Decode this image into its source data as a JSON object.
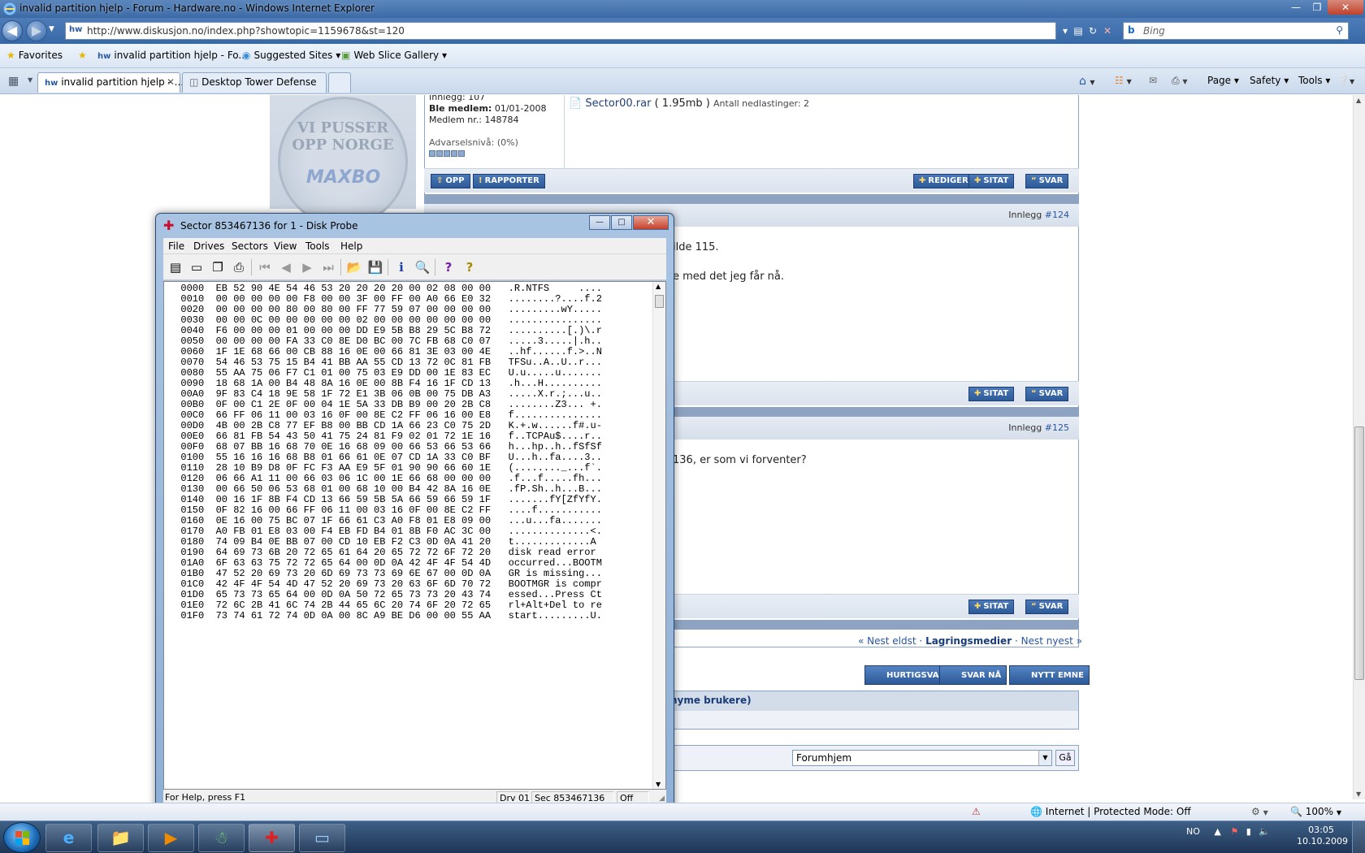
{
  "ie": {
    "title": "invalid partition hjelp - Forum - Hardware.no - Windows Internet Explorer",
    "url": "http://www.diskusjon.no/index.php?showtopic=1159678&st=120",
    "search_placeholder": "Bing",
    "favorites": {
      "favorites_label": "Favorites",
      "items": [
        "invalid partition hjelp - Fo...",
        "Suggested Sites ▾",
        "Web Slice Gallery ▾"
      ]
    },
    "tabs": [
      "invalid partition hjelp - ...",
      "Desktop Tower Defense"
    ],
    "commands": [
      "Page ▾",
      "Safety ▾",
      "Tools ▾"
    ],
    "status": {
      "zone": "Internet | Protected Mode: Off",
      "zoom": "100%"
    }
  },
  "forum": {
    "user": {
      "innlegg": "Innlegg: 107",
      "ble_medlem_label": "Ble medlem:",
      "ble_medlem": "01/01-2008",
      "medlem_nr": "Medlem nr.: 148784",
      "advarsel": "Advarselsnivå: (0%)"
    },
    "attachment": {
      "name": "Sector00.rar",
      "size": "( 1.95mb )",
      "downloads": "Antall nedlastinger: 2"
    },
    "buttons": {
      "opp": "OPP",
      "rapporter": "RAPPORTER",
      "rediger": "REDIGER",
      "sitat": "SITAT",
      "svar": "SVAR"
    },
    "posts": [
      {
        "innlegg_label": "Innlegg",
        "num": "#124",
        "line1": "ilde 115.",
        "line2": "e med det jeg får nå."
      },
      {
        "innlegg_label": "Innlegg",
        "num": "#125",
        "line1": "136, er som vi forventer?"
      }
    ],
    "pager": {
      "prev": "« Nest eldst",
      "sep": "·",
      "cat": "Lagringsmedier",
      "next": "Nest nyest »"
    },
    "big_buttons": [
      "HURTIGSVAR",
      "SVAR NÅ",
      "NYTT EMNE"
    ],
    "online_header": "nyme brukere)",
    "jump": {
      "selected": "Forumhjem",
      "go": "Gå"
    },
    "seal_top": "VI PUSSER OPP NORGE",
    "seal_logo": "MAXBO"
  },
  "diskprobe": {
    "title": "Sector 853467136 for 1 - Disk Probe",
    "menu": [
      "File",
      "Drives",
      "Sectors",
      "View",
      "Tools",
      "Help"
    ],
    "rows": [
      [
        "0000",
        "EB 52 90 4E 54 46 53 20 20 20 20 00 02 08 00 00",
        ".R.NTFS     ...."
      ],
      [
        "0010",
        "00 00 00 00 00 F8 00 00 3F 00 FF 00 A0 66 E0 32",
        "........?....f.2"
      ],
      [
        "0020",
        "00 00 00 00 80 00 80 00 FF 77 59 07 00 00 00 00",
        ".........wY....."
      ],
      [
        "0030",
        "00 00 0C 00 00 00 00 00 02 00 00 00 00 00 00 00",
        "................"
      ],
      [
        "0040",
        "F6 00 00 00 01 00 00 00 DD E9 5B B8 29 5C B8 72",
        "..........[.)\\.r"
      ],
      [
        "0050",
        "00 00 00 00 FA 33 C0 8E D0 BC 00 7C FB 68 C0 07",
        ".....3.....|.h.."
      ],
      [
        "0060",
        "1F 1E 68 66 00 CB 88 16 0E 00 66 81 3E 03 00 4E",
        "..hf......f.>..N"
      ],
      [
        "0070",
        "54 46 53 75 15 B4 41 BB AA 55 CD 13 72 0C 81 FB",
        "TFSu..A..U..r..."
      ],
      [
        "0080",
        "55 AA 75 06 F7 C1 01 00 75 03 E9 DD 00 1E 83 EC",
        "U.u.....u......."
      ],
      [
        "0090",
        "18 68 1A 00 B4 48 8A 16 0E 00 8B F4 16 1F CD 13",
        ".h...H.........."
      ],
      [
        "00A0",
        "9F 83 C4 18 9E 58 1F 72 E1 3B 06 0B 00 75 DB A3",
        ".....X.r.;...u.."
      ],
      [
        "00B0",
        "0F 00 C1 2E 0F 00 04 1E 5A 33 DB B9 00 20 2B C8",
        "........Z3... +."
      ],
      [
        "00C0",
        "66 FF 06 11 00 03 16 0F 00 8E C2 FF 06 16 00 E8",
        "f..............."
      ],
      [
        "00D0",
        "4B 00 2B C8 77 EF B8 00 BB CD 1A 66 23 C0 75 2D",
        "K.+.w......f#.u-"
      ],
      [
        "00E0",
        "66 81 FB 54 43 50 41 75 24 81 F9 02 01 72 1E 16",
        "f..TCPAu$....r.."
      ],
      [
        "00F0",
        "68 07 BB 16 68 70 0E 16 68 09 00 66 53 66 53 66",
        "h...hp..h..fSfSf"
      ],
      [
        "0100",
        "55 16 16 16 68 B8 01 66 61 0E 07 CD 1A 33 C0 BF",
        "U...h..fa....3.."
      ],
      [
        "0110",
        "28 10 B9 D8 0F FC F3 AA E9 5F 01 90 90 66 60 1E",
        "(........_...f`."
      ],
      [
        "0120",
        "06 66 A1 11 00 66 03 06 1C 00 1E 66 68 00 00 00",
        ".f...f.....fh..."
      ],
      [
        "0130",
        "00 66 50 06 53 68 01 00 68 10 00 B4 42 8A 16 0E",
        ".fP.Sh..h...B..."
      ],
      [
        "0140",
        "00 16 1F 8B F4 CD 13 66 59 5B 5A 66 59 66 59 1F",
        ".......fY[ZfYfY."
      ],
      [
        "0150",
        "0F 82 16 00 66 FF 06 11 00 03 16 0F 00 8E C2 FF",
        "....f..........."
      ],
      [
        "0160",
        "0E 16 00 75 BC 07 1F 66 61 C3 A0 F8 01 E8 09 00",
        "...u...fa......."
      ],
      [
        "0170",
        "A0 FB 01 E8 03 00 F4 EB FD B4 01 8B F0 AC 3C 00",
        "..............<."
      ],
      [
        "0180",
        "74 09 B4 0E BB 07 00 CD 10 EB F2 C3 0D 0A 41 20",
        "t.............A "
      ],
      [
        "0190",
        "64 69 73 6B 20 72 65 61 64 20 65 72 72 6F 72 20",
        "disk read error "
      ],
      [
        "01A0",
        "6F 63 63 75 72 72 65 64 00 0D 0A 42 4F 4F 54 4D",
        "occurred...BOOTM"
      ],
      [
        "01B0",
        "47 52 20 69 73 20 6D 69 73 73 69 6E 67 00 0D 0A",
        "GR is missing..."
      ],
      [
        "01C0",
        "42 4F 4F 54 4D 47 52 20 69 73 20 63 6F 6D 70 72",
        "BOOTMGR is compr"
      ],
      [
        "01D0",
        "65 73 73 65 64 00 0D 0A 50 72 65 73 73 20 43 74",
        "essed...Press Ct"
      ],
      [
        "01E0",
        "72 6C 2B 41 6C 74 2B 44 65 6C 20 74 6F 20 72 65",
        "rl+Alt+Del to re"
      ],
      [
        "01F0",
        "73 74 61 72 74 0D 0A 00 8C A9 BE D6 00 00 55 AA",
        "start.........U."
      ]
    ],
    "status": {
      "help": "For Help, press F1",
      "drive": "Drv 01",
      "sector": "Sec 853467136",
      "mode": "Off"
    }
  },
  "taskbar": {
    "lang": "NO",
    "time": "03:05",
    "date": "10.10.2009"
  },
  "colors": {
    "accent": "#2d5a98",
    "title_bg": "#3c6aa5"
  }
}
